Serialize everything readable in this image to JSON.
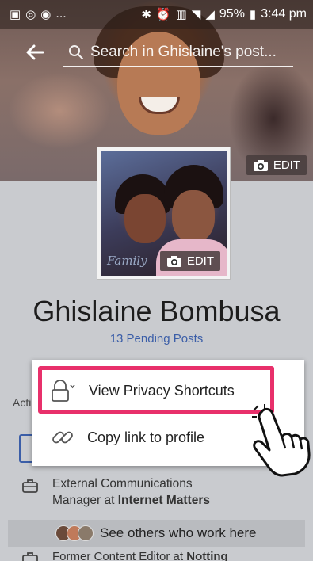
{
  "status_bar": {
    "left_icons": [
      "gallery-icon",
      "whatsapp-icon",
      "messenger-icon"
    ],
    "left_more": "...",
    "battery": "95%",
    "time": "3:44 pm"
  },
  "search": {
    "placeholder": "Search in Ghislaine's post..."
  },
  "cover": {
    "edit_label": "EDIT"
  },
  "profile_pic": {
    "edit_label": "EDIT",
    "watermark": "Family"
  },
  "profile": {
    "name": "Ghislaine Bombusa",
    "pending_posts": "13 Pending Posts",
    "actions_cut": "Acti"
  },
  "menu": {
    "items": [
      {
        "label": "View Privacy Shortcuts",
        "icon": "lock-icon"
      },
      {
        "label": "Copy link to profile",
        "icon": "link-icon"
      }
    ]
  },
  "work": [
    {
      "title": "External Communications",
      "line2_prefix": "Manager at ",
      "company": "Internet Matters"
    },
    {
      "title": "Former Content Editor at ",
      "company": "Notting"
    }
  ],
  "see_others": "See others who work here",
  "colors": {
    "highlight": "#e8306b",
    "link_blue": "#3b5ea8",
    "page_gray": "#c9cbcf"
  }
}
